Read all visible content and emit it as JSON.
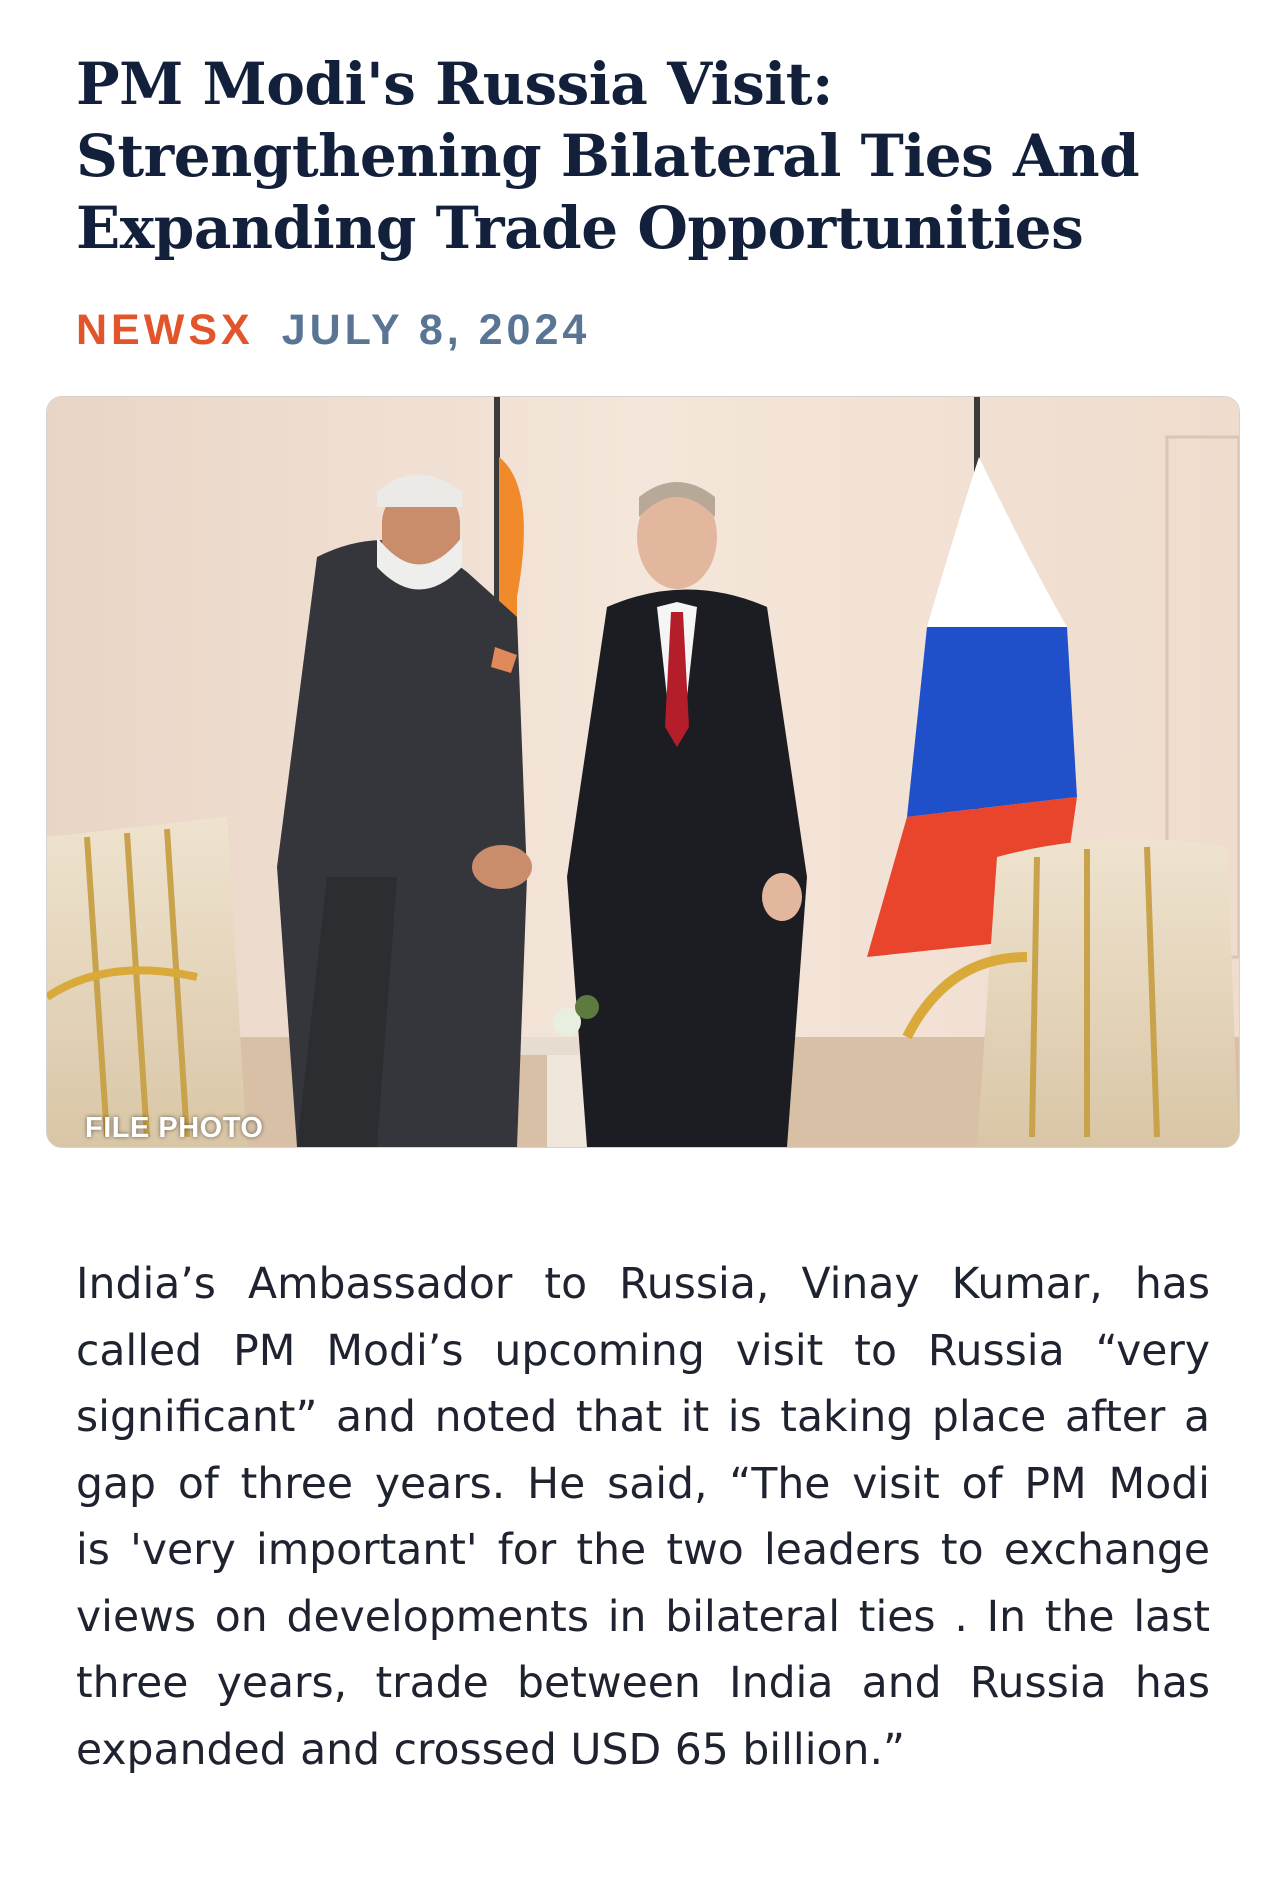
{
  "article": {
    "headline_lines": [
      "PM Modi's Russia Visit:",
      "Strengthening Bilateral Ties And",
      "Expanding Trade Opportunities"
    ],
    "source": "NEWSX",
    "date": "JULY 8, 2024",
    "image_caption": "FILE PHOTO",
    "body_lines": [
      "India’s Ambassador to Russia, Vinay Kumar, has",
      "called PM Modi’s upcoming visit to Russia “very",
      "significant” and noted that it is taking place after a",
      "gap of three years. He said, “The visit of PM Modi",
      "is 'very important' for the two leaders to exchange",
      "views on developments in bilateral ties . In the last",
      "three years, trade between India and Russia has",
      "expanded and crossed USD 65 billion.”"
    ]
  },
  "colors": {
    "headline": "#13203b",
    "source": "#e2542a",
    "date": "#5a7493",
    "body": "#1f2330"
  }
}
